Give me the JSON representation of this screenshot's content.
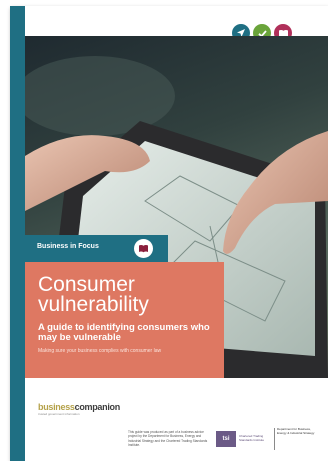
{
  "banner": {
    "label": "Business in Focus"
  },
  "title": {
    "line1": "Consumer",
    "line2": "vulnerability"
  },
  "subtitle": "A guide to identifying consumers who may be vulnerable",
  "tagline": "Making sure your business complies with consumer law",
  "icons": [
    "navigation-icon",
    "checkmark-icon",
    "book-icon"
  ],
  "footer": {
    "bc_logo": {
      "word_part1": "business",
      "word_part2": "companion",
      "strapline": "trusted government information"
    },
    "credit": "This guide was produced as part of a business advice project by the Department for Business, Energy and Industrial Strategy and the Chartered Trading Standards Institute.",
    "tsi": {
      "mark": "tsi",
      "text": "Chartered Trading Standards Institute"
    },
    "dept": {
      "text": "Department for Business, Energy & Industrial Strategy"
    }
  },
  "colors": {
    "teal": "#1f6f83",
    "coral": "#de7862",
    "green": "#6aa43a",
    "magenta": "#b0305a",
    "mustard": "#b5a24a",
    "purple": "#6b5a86"
  }
}
